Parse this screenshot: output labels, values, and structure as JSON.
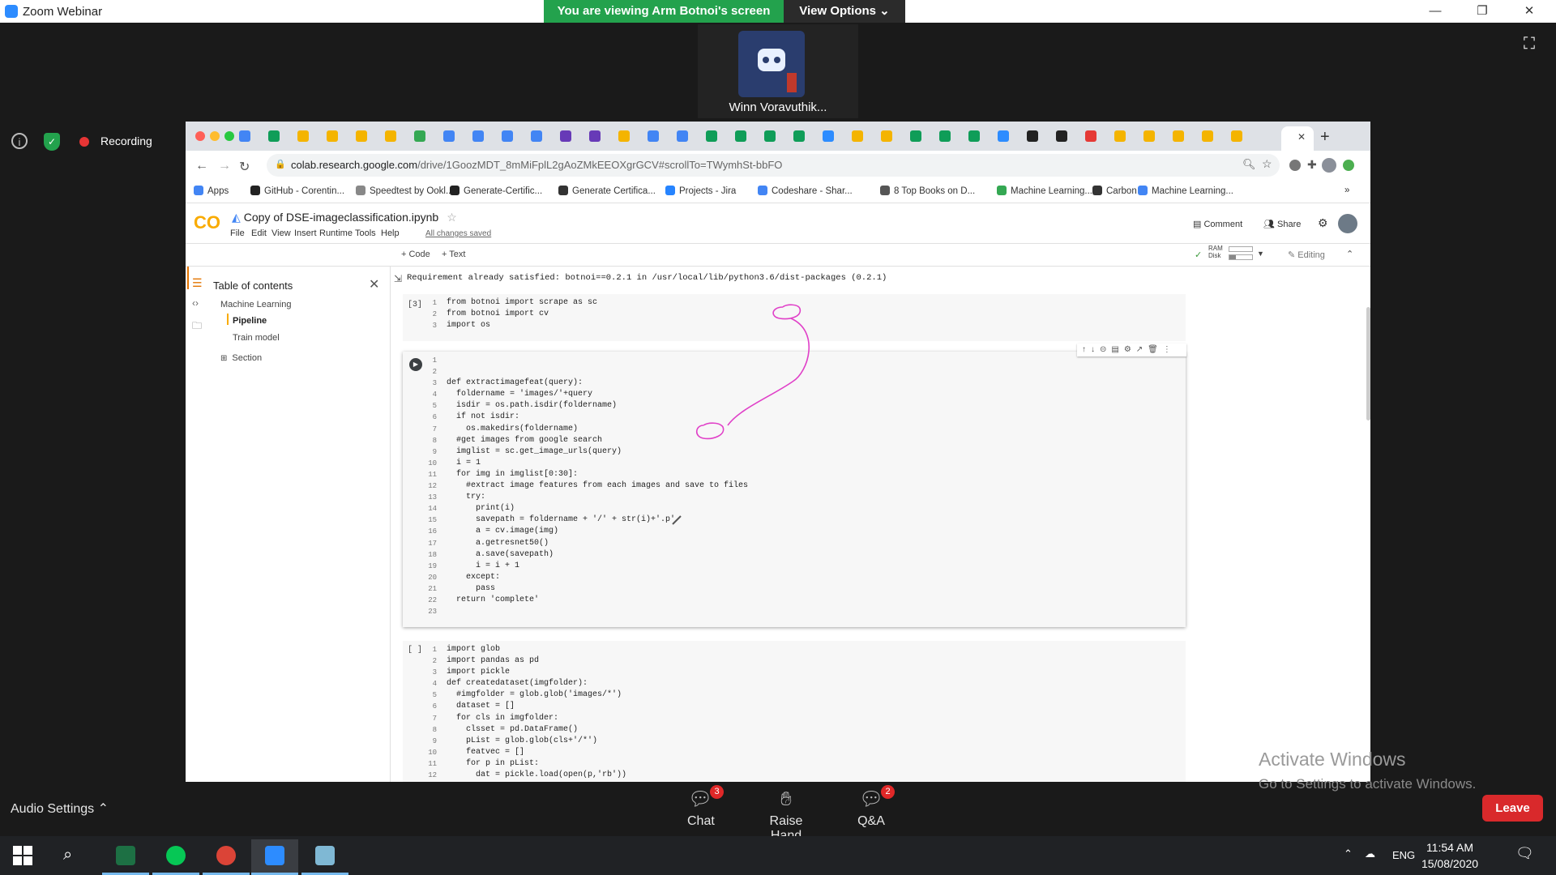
{
  "window": {
    "title": "Zoom Webinar"
  },
  "banner": {
    "viewing": "You are viewing Arm Botnoi's screen",
    "view_options": "View Options ⌄"
  },
  "participant": {
    "name": "Winn Voravuthik..."
  },
  "overlay": {
    "recording": "Recording"
  },
  "browser": {
    "url_host": "colab.research.google.com",
    "url_path": "/drive/1GoozMDT_8mMiFplL2gAoZMkEEOXgrGCV#scrollTo=TWymhSt-bbFO",
    "bookmarks": [
      "Apps",
      "GitHub - Corentin...",
      "Speedtest by Ookl...",
      "Generate-Certific...",
      "Generate Certifica...",
      "Projects - Jira",
      "Codeshare - Shar...",
      "8 Top Books on D...",
      "Machine Learning...",
      "Carbon",
      "Machine Learning...",
      "»"
    ]
  },
  "colab": {
    "logo": "CO",
    "title": "Copy of DSE-imageclassification.ipynb",
    "menu": [
      "File",
      "Edit",
      "View",
      "Insert",
      "Runtime",
      "Tools",
      "Help"
    ],
    "saved": "All changes saved",
    "comment": "Comment",
    "share": "Share",
    "add_code": "+ Code",
    "add_text": "+ Text",
    "ram": "RAM",
    "disk": "Disk",
    "editing": "Editing"
  },
  "toc": {
    "title": "Table of contents",
    "items": [
      "Machine Learning",
      "Pipeline",
      "Train model",
      "Section"
    ]
  },
  "output_line": "Requirement already satisfied: botnoi==0.2.1 in /usr/local/lib/python3.6/dist-packages (0.2.1)",
  "cells": [
    {
      "label": "[3]",
      "lines": [
        "from botnoi import scrape as sc",
        "from botnoi import cv",
        "import os"
      ]
    },
    {
      "label": "",
      "lines": [
        "",
        "",
        "def extractimagefeat(query):",
        "  foldername = 'images/'+query",
        "  isdir = os.path.isdir(foldername)",
        "  if not isdir:",
        "    os.makedirs(foldername)",
        "  #get images from google search",
        "  imglist = sc.get_image_urls(query)",
        "  i = 1",
        "  for img in imglist[0:30]:",
        "    #extract image features from each images and save to files",
        "    try:",
        "      print(i)",
        "      savepath = foldername + '/' + str(i)+'.p'",
        "      a = cv.image(img)",
        "      a.getresnet50()",
        "      a.save(savepath)",
        "      i = i + 1",
        "    except:",
        "      pass",
        "  return 'complete'",
        ""
      ]
    },
    {
      "label": "[ ]",
      "lines": [
        "import glob",
        "import pandas as pd",
        "import pickle",
        "def createdataset(imgfolder):",
        "  #imgfolder = glob.glob('images/*')",
        "  dataset = []",
        "  for cls in imgfolder:",
        "    clsset = pd.DataFrame()",
        "    pList = glob.glob(cls+'/*')",
        "    featvec = []",
        "    for p in pList:",
        "      dat = pickle.load(open(p,'rb'))"
      ]
    }
  ],
  "watermark": {
    "line1": "Activate Windows",
    "line2": "Go to Settings to activate Windows."
  },
  "controls": {
    "audio": "Audio Settings ⌃",
    "chat": "Chat",
    "chat_badge": "3",
    "raise": "Raise Hand",
    "qa": "Q&A",
    "qa_badge": "2",
    "leave": "Leave"
  },
  "taskbar": {
    "lang": "ENG",
    "time": "11:54 AM",
    "date": "15/08/2020"
  }
}
